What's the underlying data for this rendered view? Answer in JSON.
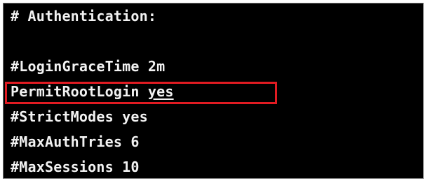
{
  "terminal": {
    "lines": {
      "auth_header": "# Authentication:",
      "blank": "",
      "login_grace_time": "#LoginGraceTime 2m",
      "permit_root_login_key": "PermitRootLogin ",
      "permit_root_login_value": "yes",
      "strict_modes": "#StrictModes yes",
      "max_auth_tries": "#MaxAuthTries 6",
      "max_sessions": "#MaxSessions 10"
    }
  },
  "colors": {
    "terminal_background": "#000000",
    "terminal_text": "#f2f2f2",
    "highlight_box": "#e11b22"
  }
}
